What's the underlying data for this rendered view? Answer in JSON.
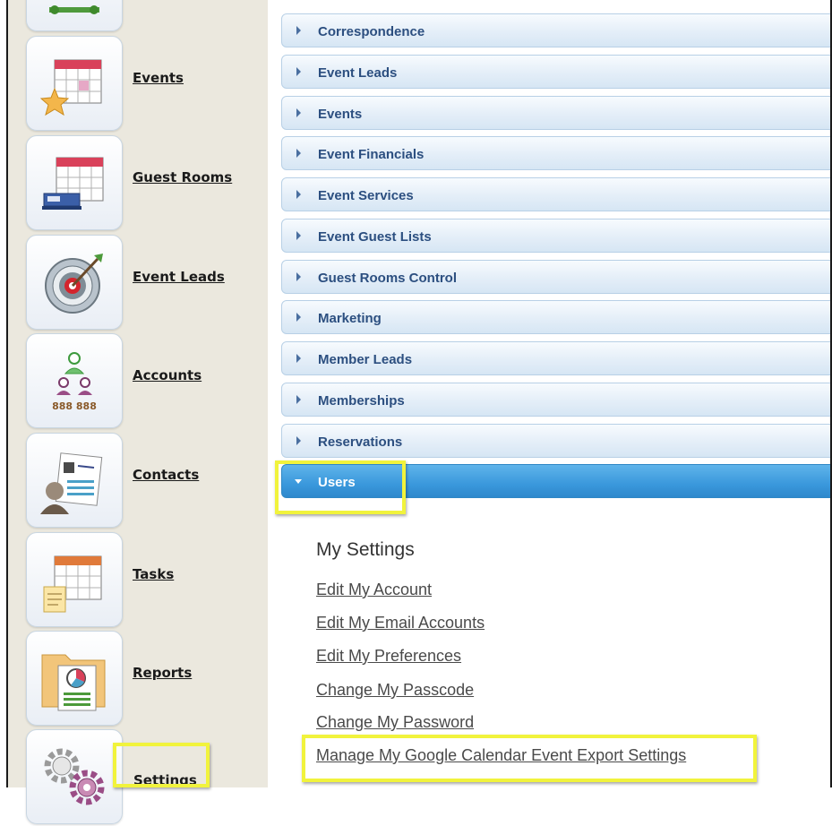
{
  "nav": {
    "items": [
      {
        "label": "",
        "icon": "layout-icon"
      },
      {
        "label": "Events",
        "icon": "events-calendar-star-icon"
      },
      {
        "label": "Guest Rooms",
        "icon": "guest-rooms-calendar-icon"
      },
      {
        "label": "Event Leads",
        "icon": "target-icon"
      },
      {
        "label": "Accounts",
        "icon": "accounts-people-icon"
      },
      {
        "label": "Contacts",
        "icon": "contacts-card-icon"
      },
      {
        "label": "Tasks",
        "icon": "tasks-calendar-icon"
      },
      {
        "label": "Reports",
        "icon": "reports-folder-icon"
      },
      {
        "label": "Settings",
        "icon": "gears-icon"
      }
    ]
  },
  "accordion": {
    "sections": [
      {
        "label": "Correspondence"
      },
      {
        "label": "Event Leads"
      },
      {
        "label": "Events"
      },
      {
        "label": "Event Financials"
      },
      {
        "label": "Event Services"
      },
      {
        "label": "Event Guest Lists"
      },
      {
        "label": "Guest Rooms Control"
      },
      {
        "label": "Marketing"
      },
      {
        "label": "Member Leads"
      },
      {
        "label": "Memberships"
      },
      {
        "label": "Reservations"
      }
    ],
    "active": {
      "label": "Users"
    }
  },
  "users_panel": {
    "title": "My Settings",
    "links": [
      {
        "label": "Edit My Account"
      },
      {
        "label": "Edit My Email Accounts"
      },
      {
        "label": "Edit My Preferences"
      },
      {
        "label": "Change My Passcode"
      },
      {
        "label": "Change My Password"
      },
      {
        "label": "Manage My Google Calendar Event Export Settings"
      }
    ]
  },
  "colors": {
    "highlight": "#f1f33c",
    "active_header": "#3a98dc",
    "header_text": "#2c4f80",
    "nav_background": "#ebe8de"
  }
}
